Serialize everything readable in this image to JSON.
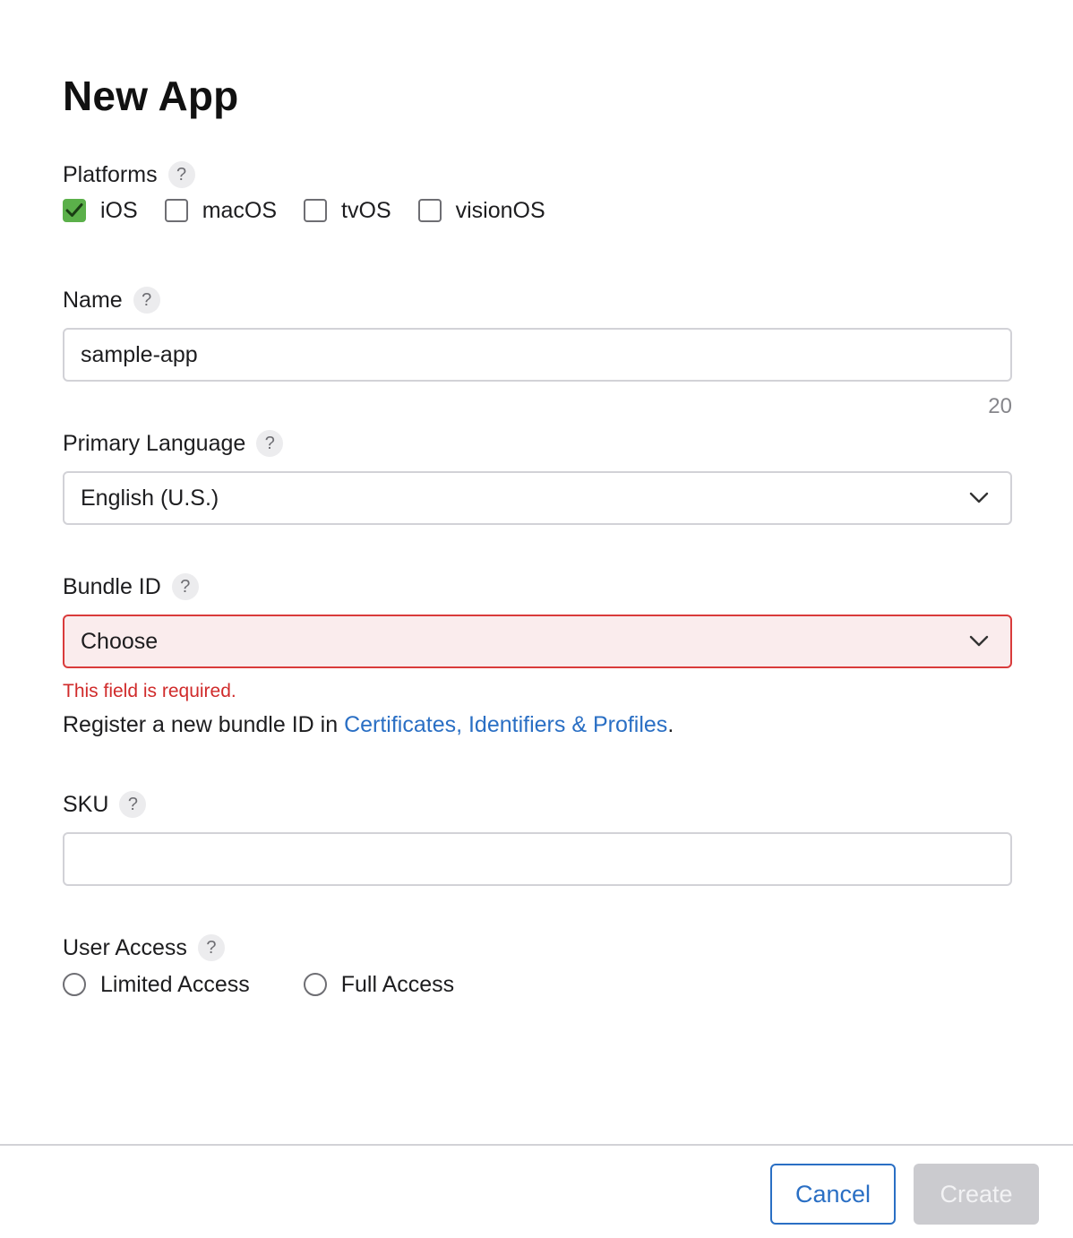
{
  "dialog": {
    "title": "New App"
  },
  "platforms": {
    "label": "Platforms",
    "help": "?",
    "options": [
      {
        "label": "iOS",
        "checked": true
      },
      {
        "label": "macOS",
        "checked": false
      },
      {
        "label": "tvOS",
        "checked": false
      },
      {
        "label": "visionOS",
        "checked": false
      }
    ]
  },
  "name": {
    "label": "Name",
    "help": "?",
    "value": "sample-app",
    "remaining": "20"
  },
  "primary_language": {
    "label": "Primary Language",
    "help": "?",
    "selected": "English (U.S.)"
  },
  "bundle_id": {
    "label": "Bundle ID",
    "help": "?",
    "selected": "Choose",
    "error": "This field is required.",
    "helper_prefix": "Register a new bundle ID in ",
    "helper_link": "Certificates, Identifiers & Profiles",
    "helper_suffix": "."
  },
  "sku": {
    "label": "SKU",
    "help": "?",
    "value": ""
  },
  "user_access": {
    "label": "User Access",
    "help": "?",
    "options": [
      {
        "label": "Limited Access",
        "selected": false
      },
      {
        "label": "Full Access",
        "selected": false
      }
    ]
  },
  "footer": {
    "cancel_label": "Cancel",
    "create_label": "Create"
  },
  "colors": {
    "accent": "#2a6fc4",
    "check": "#5bb04a",
    "error": "#d93b3b",
    "error_bg": "#faeced"
  }
}
